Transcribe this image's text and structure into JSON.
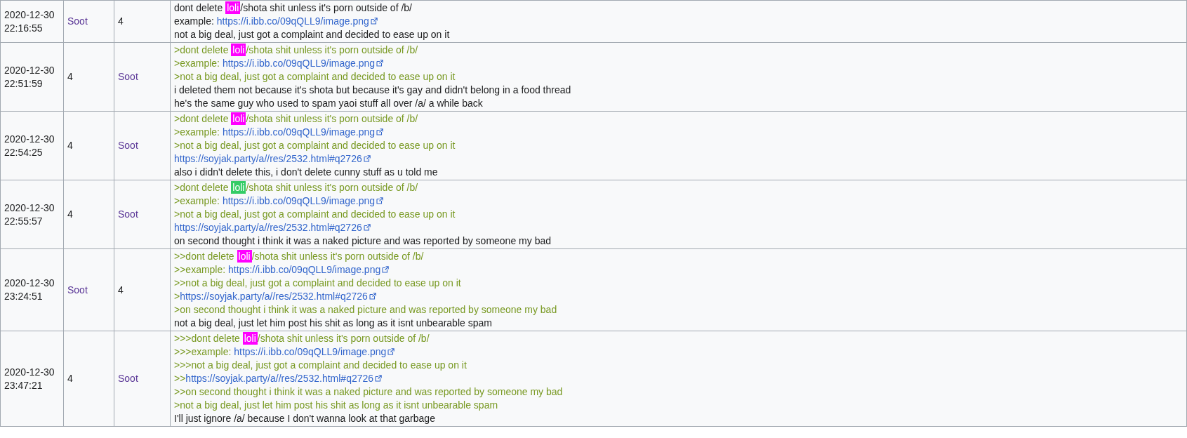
{
  "rows": [
    {
      "cells": [
        {
          "kind": "text",
          "text": "2020-12-30 22:16:55"
        },
        {
          "kind": "user",
          "text": "Soot"
        },
        {
          "kind": "text",
          "text": "4"
        }
      ],
      "lines": [
        {
          "kind": "plain",
          "segments": [
            {
              "kind": "text",
              "text": "dont delete "
            },
            {
              "kind": "highlight",
              "text": "loli",
              "color": "#ff00ff"
            },
            {
              "kind": "text",
              "text": "/shota shit unless it's porn outside of /b/"
            }
          ]
        },
        {
          "kind": "plain",
          "segments": [
            {
              "kind": "text",
              "text": "example: "
            },
            {
              "kind": "link",
              "text": "https://i.ibb.co/09qQLL9/image.png"
            }
          ]
        },
        {
          "kind": "plain",
          "segments": [
            {
              "kind": "text",
              "text": "not a big deal, just got a complaint and decided to ease up on it"
            }
          ]
        }
      ]
    },
    {
      "cells": [
        {
          "kind": "text",
          "text": "2020-12-30 22:51:59"
        },
        {
          "kind": "text",
          "text": "4"
        },
        {
          "kind": "user",
          "text": "Soot"
        }
      ],
      "lines": [
        {
          "kind": "quote",
          "segments": [
            {
              "kind": "text",
              "text": ">dont delete "
            },
            {
              "kind": "highlight",
              "text": "loli",
              "color": "#ff00ff"
            },
            {
              "kind": "text",
              "text": "/shota shit unless it's porn outside of /b/"
            }
          ]
        },
        {
          "kind": "quote",
          "segments": [
            {
              "kind": "text",
              "text": ">example: "
            },
            {
              "kind": "link",
              "text": "https://i.ibb.co/09qQLL9/image.png"
            }
          ]
        },
        {
          "kind": "quote",
          "segments": [
            {
              "kind": "text",
              "text": ">not a big deal, just got a complaint and decided to ease up on it"
            }
          ]
        },
        {
          "kind": "plain",
          "segments": [
            {
              "kind": "text",
              "text": "i deleted them not because it's shota but because it's gay and didn't belong in a food thread"
            }
          ]
        },
        {
          "kind": "plain",
          "segments": [
            {
              "kind": "text",
              "text": "he's the same guy who used to spam yaoi stuff all over /a/ a while back"
            }
          ]
        }
      ]
    },
    {
      "cells": [
        {
          "kind": "text",
          "text": "2020-12-30 22:54:25"
        },
        {
          "kind": "text",
          "text": "4"
        },
        {
          "kind": "user",
          "text": "Soot"
        }
      ],
      "lines": [
        {
          "kind": "quote",
          "segments": [
            {
              "kind": "text",
              "text": ">dont delete "
            },
            {
              "kind": "highlight",
              "text": "loli",
              "color": "#ff00ff"
            },
            {
              "kind": "text",
              "text": "/shota shit unless it's porn outside of /b/"
            }
          ]
        },
        {
          "kind": "quote",
          "segments": [
            {
              "kind": "text",
              "text": ">example: "
            },
            {
              "kind": "link",
              "text": "https://i.ibb.co/09qQLL9/image.png"
            }
          ]
        },
        {
          "kind": "quote",
          "segments": [
            {
              "kind": "text",
              "text": ">not a big deal, just got a complaint and decided to ease up on it"
            }
          ]
        },
        {
          "kind": "plain",
          "segments": [
            {
              "kind": "link",
              "text": "https://soyjak.party/a//res/2532.html#q2726"
            }
          ]
        },
        {
          "kind": "plain",
          "segments": [
            {
              "kind": "text",
              "text": "also i didn't delete this, i don't delete cunny stuff as u told me"
            }
          ]
        }
      ]
    },
    {
      "cells": [
        {
          "kind": "text",
          "text": "2020-12-30 22:55:57"
        },
        {
          "kind": "text",
          "text": "4"
        },
        {
          "kind": "user",
          "text": "Soot"
        }
      ],
      "lines": [
        {
          "kind": "quote",
          "segments": [
            {
              "kind": "text",
              "text": ">dont delete "
            },
            {
              "kind": "highlight",
              "text": "loli",
              "color": "#33cc66"
            },
            {
              "kind": "text",
              "text": "/shota shit unless it's porn outside of /b/"
            }
          ]
        },
        {
          "kind": "quote",
          "segments": [
            {
              "kind": "text",
              "text": ">example: "
            },
            {
              "kind": "link",
              "text": "https://i.ibb.co/09qQLL9/image.png"
            }
          ]
        },
        {
          "kind": "quote",
          "segments": [
            {
              "kind": "text",
              "text": ">not a big deal, just got a complaint and decided to ease up on it"
            }
          ]
        },
        {
          "kind": "plain",
          "segments": [
            {
              "kind": "link",
              "text": "https://soyjak.party/a//res/2532.html#q2726"
            }
          ]
        },
        {
          "kind": "plain",
          "segments": [
            {
              "kind": "text",
              "text": "on second thought i think it was a naked picture and was reported by someone my bad"
            }
          ]
        }
      ]
    },
    {
      "cells": [
        {
          "kind": "text",
          "text": "2020-12-30 23:24:51"
        },
        {
          "kind": "user",
          "text": "Soot"
        },
        {
          "kind": "text",
          "text": "4"
        }
      ],
      "lines": [
        {
          "kind": "quote",
          "segments": [
            {
              "kind": "text",
              "text": ">>dont delete "
            },
            {
              "kind": "highlight",
              "text": "loli",
              "color": "#ff00ff"
            },
            {
              "kind": "text",
              "text": "/shota shit unless it's porn outside of /b/"
            }
          ]
        },
        {
          "kind": "quote",
          "segments": [
            {
              "kind": "text",
              "text": ">>example: "
            },
            {
              "kind": "link",
              "text": "https://i.ibb.co/09qQLL9/image.png"
            }
          ]
        },
        {
          "kind": "quote",
          "segments": [
            {
              "kind": "text",
              "text": ">>not a big deal, just got a complaint and decided to ease up on it"
            }
          ]
        },
        {
          "kind": "quote",
          "segments": [
            {
              "kind": "text",
              "text": ">"
            },
            {
              "kind": "link",
              "text": "https://soyjak.party/a//res/2532.html#q2726"
            }
          ]
        },
        {
          "kind": "quote",
          "segments": [
            {
              "kind": "text",
              "text": ">on second thought i think it was a naked picture and was reported by someone my bad"
            }
          ]
        },
        {
          "kind": "plain",
          "segments": [
            {
              "kind": "text",
              "text": "not a big deal, just let him post his shit as long as it isnt unbearable spam"
            }
          ]
        }
      ]
    },
    {
      "cells": [
        {
          "kind": "text",
          "text": "2020-12-30 23:47:21"
        },
        {
          "kind": "text",
          "text": "4"
        },
        {
          "kind": "user",
          "text": "Soot"
        }
      ],
      "lines": [
        {
          "kind": "quote",
          "segments": [
            {
              "kind": "text",
              "text": ">>>dont delete "
            },
            {
              "kind": "highlight",
              "text": "loli",
              "color": "#ff00ff"
            },
            {
              "kind": "text",
              "text": "/shota shit unless it's porn outside of /b/"
            }
          ]
        },
        {
          "kind": "quote",
          "segments": [
            {
              "kind": "text",
              "text": ">>>example: "
            },
            {
              "kind": "link",
              "text": "https://i.ibb.co/09qQLL9/image.png"
            }
          ]
        },
        {
          "kind": "quote",
          "segments": [
            {
              "kind": "text",
              "text": ">>>not a big deal, just got a complaint and decided to ease up on it"
            }
          ]
        },
        {
          "kind": "quote",
          "segments": [
            {
              "kind": "text",
              "text": ">>"
            },
            {
              "kind": "link",
              "text": "https://soyjak.party/a//res/2532.html#q2726"
            }
          ]
        },
        {
          "kind": "quote",
          "segments": [
            {
              "kind": "text",
              "text": ">>on second thought i think it was a naked picture and was reported by someone my bad"
            }
          ]
        },
        {
          "kind": "quote",
          "segments": [
            {
              "kind": "text",
              "text": ">not a big deal, just let him post his shit as long as it isnt unbearable spam"
            }
          ]
        },
        {
          "kind": "plain",
          "segments": [
            {
              "kind": "text",
              "text": "I'll just ignore /a/ because I don't wanna look at that garbage"
            }
          ]
        }
      ]
    }
  ]
}
